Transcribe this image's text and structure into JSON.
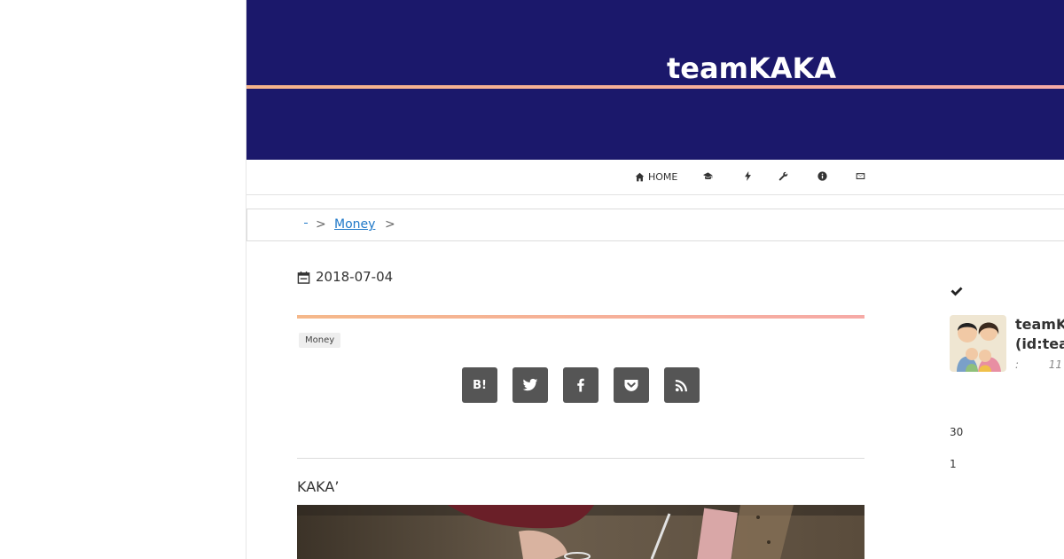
{
  "site": {
    "title": "teamKAKA"
  },
  "nav": {
    "home_label": "HOME",
    "items": [
      {
        "icon": "graduation-cap-icon"
      },
      {
        "icon": "bolt-icon"
      },
      {
        "icon": "wrench-icon"
      },
      {
        "icon": "info-icon"
      },
      {
        "icon": "envelope-icon"
      }
    ]
  },
  "breadcrumb": {
    "home_text": "",
    "separator": ">",
    "category": "Money"
  },
  "article": {
    "date": "2018-07-04",
    "category": "Money",
    "share": [
      {
        "icon": "hatena-bookmark-icon",
        "label": "B!"
      },
      {
        "icon": "twitter-icon"
      },
      {
        "icon": "facebook-icon"
      },
      {
        "icon": "pocket-icon"
      },
      {
        "icon": "rss-icon"
      }
    ],
    "intro": "KAKA’"
  },
  "sidebar": {
    "profile": {
      "name_line1": "teamK",
      "name_line2": "(id:tea",
      "meta_left": ":",
      "meta_right": "11"
    },
    "count1": "30",
    "count2": "1"
  },
  "colors": {
    "header_bg": "#1b186b",
    "accent_line": "#f5b38a",
    "link": "#1f78c8",
    "share_bg": "#555555"
  }
}
